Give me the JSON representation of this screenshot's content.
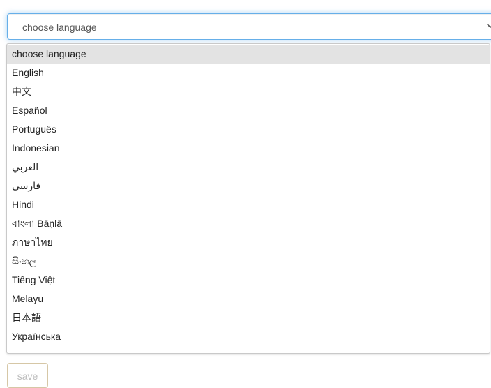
{
  "language_select": {
    "value": "choose language",
    "icon": "chevron-down-icon",
    "focus_color": "#66afe9"
  },
  "dropdown": {
    "options": [
      "choose language",
      "English",
      "中文",
      "Español",
      "Português",
      "Indonesian",
      "العربي",
      "فارسی",
      "Hindi",
      "বাংলা Bāṇlā",
      "ภาษาไทย",
      "සිංහල",
      "Tiếng Việt",
      "Melayu",
      "日本語",
      "Українська"
    ],
    "selected_option": "choose language"
  },
  "actions": {
    "save_label": "save"
  }
}
